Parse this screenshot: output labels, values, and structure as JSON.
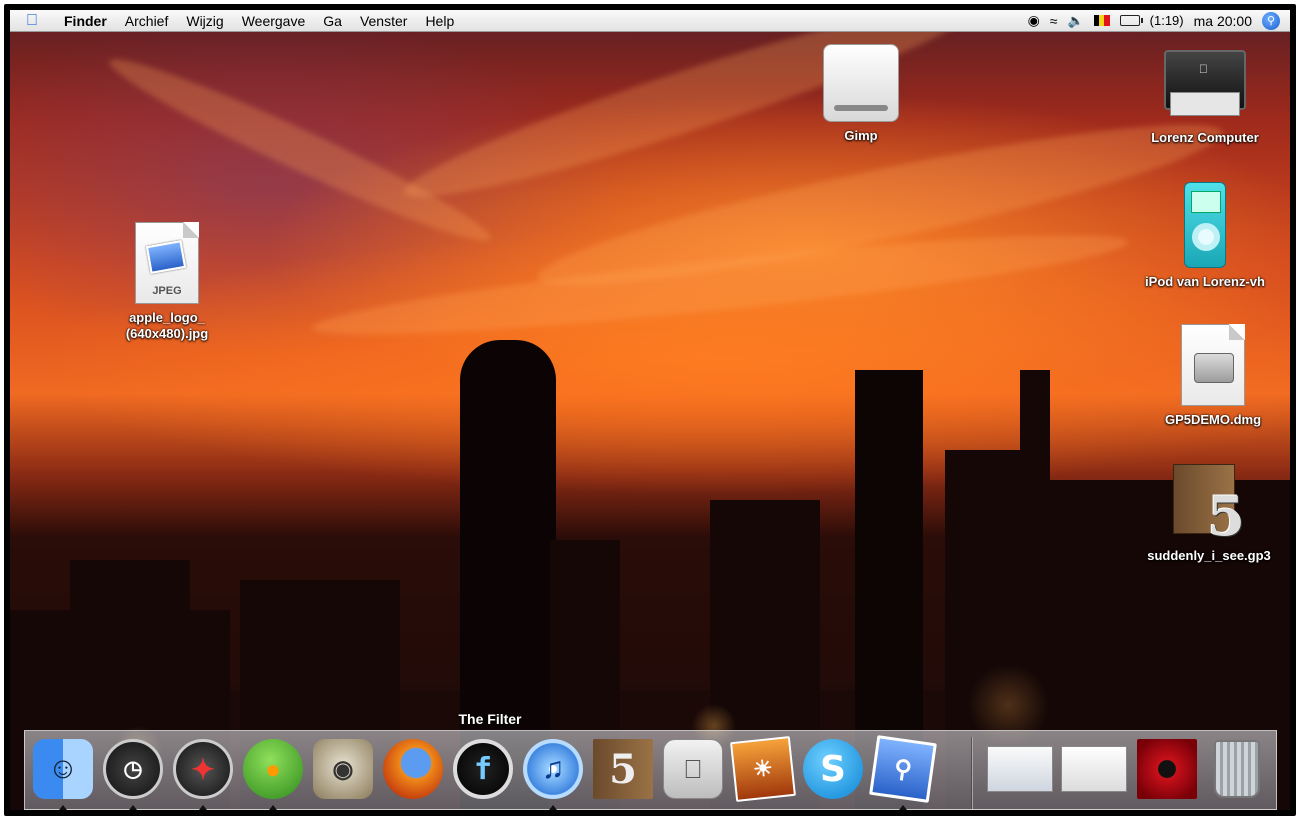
{
  "menubar": {
    "items": [
      "Finder",
      "Archief",
      "Wijzig",
      "Weergave",
      "Ga",
      "Venster",
      "Help"
    ],
    "battery_text": "(1:19)",
    "clock": "ma 20:00"
  },
  "desktop_icons": [
    {
      "label": "Gimp"
    },
    {
      "label": "Lorenz Computer"
    },
    {
      "label": "iPod van Lorenz-vh"
    },
    {
      "label": "GP5DEMO.dmg"
    },
    {
      "label": "suddenly_i_see.gp3"
    },
    {
      "label": "apple_logo_\n(640x480).jpg",
      "badge": "JPEG"
    }
  ],
  "dock": {
    "tooltip": "The Filter",
    "items": [
      {
        "name": "finder",
        "running": true
      },
      {
        "name": "dashboard",
        "running": true
      },
      {
        "name": "safari",
        "running": true
      },
      {
        "name": "adium",
        "running": true
      },
      {
        "name": "gimp",
        "running": false
      },
      {
        "name": "firefox",
        "running": false
      },
      {
        "name": "the-filter",
        "running": false
      },
      {
        "name": "itunes",
        "running": true
      },
      {
        "name": "guitar-pro",
        "running": false
      },
      {
        "name": "system-preferences",
        "running": false
      },
      {
        "name": "iphoto",
        "running": false
      },
      {
        "name": "skype",
        "running": false
      },
      {
        "name": "preview",
        "running": true
      }
    ]
  }
}
